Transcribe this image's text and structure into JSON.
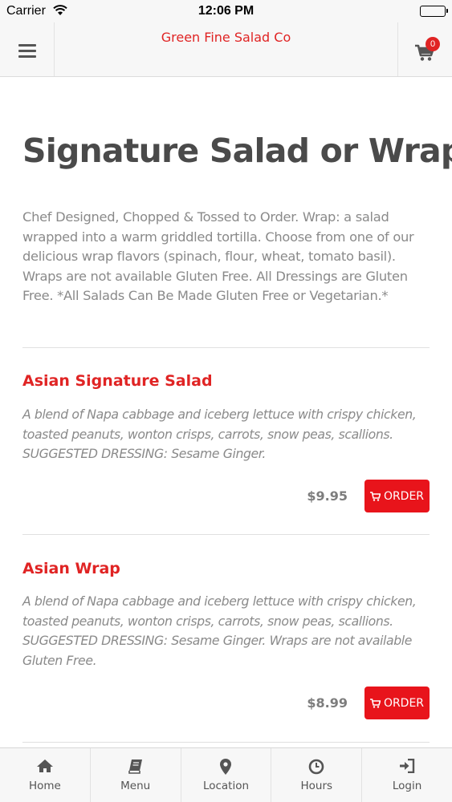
{
  "status_bar": {
    "carrier": "Carrier",
    "time": "12:06 PM"
  },
  "header": {
    "title": "Green Fine Salad Co",
    "cart_count": "0"
  },
  "page": {
    "title": "Signature Salad or Wrap",
    "description": "Chef Designed, Chopped & Tossed to Order. Wrap: a salad wrapped into a warm griddled tortilla. Choose from one of our delicious wrap flavors (spinach, flour, wheat, tomato basil). Wraps are not available Gluten Free. All Dressings are Gluten Free. *All Salads Can Be Made Gluten Free or Vegetarian.*"
  },
  "items": [
    {
      "name": "Asian Signature Salad",
      "description": "A blend of Napa cabbage and iceberg lettuce with crispy chicken, toasted peanuts, wonton crisps, carrots, snow peas, scallions. SUGGESTED DRESSING: Sesame Ginger.",
      "price": "$9.95",
      "order_label": "ORDER"
    },
    {
      "name": "Asian Wrap",
      "description": "A blend of Napa cabbage and iceberg lettuce with crispy chicken, toasted peanuts, wonton crisps, carrots, snow peas, scallions. SUGGESTED DRESSING: Sesame Ginger. Wraps are not available Gluten Free.",
      "price": "$8.99",
      "order_label": "ORDER"
    }
  ],
  "tabs": [
    {
      "label": "Home",
      "icon": "home-icon"
    },
    {
      "label": "Menu",
      "icon": "book-icon"
    },
    {
      "label": "Location",
      "icon": "map-pin-icon"
    },
    {
      "label": "Hours",
      "icon": "clock-icon"
    },
    {
      "label": "Login",
      "icon": "login-icon"
    }
  ],
  "colors": {
    "accent": "#e02424",
    "button": "#e8141b",
    "text": "#4a4a4a",
    "muted": "#8a8a8a"
  }
}
